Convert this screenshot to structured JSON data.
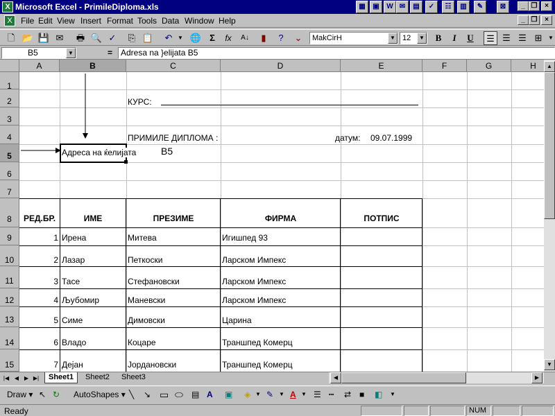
{
  "window": {
    "title": "Microsoft Excel - PrimileDiploma.xls",
    "app_icon_label": "X"
  },
  "menu": [
    "File",
    "Edit",
    "View",
    "Insert",
    "Format",
    "Tools",
    "Data",
    "Window",
    "Help"
  ],
  "toolbar": {
    "font_name": "MakCirH",
    "font_size": "12",
    "bold": "B",
    "italic": "I",
    "underline": "U"
  },
  "formula_bar": {
    "name_box": "B5",
    "equals": "=",
    "formula": "Adresa na }elijata B5"
  },
  "columns": [
    "A",
    "B",
    "C",
    "D",
    "E",
    "F",
    "G",
    "H"
  ],
  "rows": [
    "1",
    "2",
    "3",
    "4",
    "5",
    "6",
    "7",
    "8",
    "9",
    "10",
    "11",
    "12",
    "13",
    "14",
    "15"
  ],
  "sheet": {
    "course_label": "КУРС:",
    "received_label": "ПРИМИЛЕ ДИПЛОМА :",
    "date_label": "датум:",
    "date_value": "09.07.1999",
    "b5_text": "Адреса на ќелијата",
    "b5_ref": "B5",
    "headers": [
      "РЕД.БР.",
      "ИМЕ",
      "ПРЕЗИМЕ",
      "ФИРМА",
      "ПОТПИС"
    ],
    "data_rows": [
      {
        "no": "1",
        "name": "Ирена",
        "surname": "Митева",
        "company": "Игишпед 93"
      },
      {
        "no": "2",
        "name": "Лазар",
        "surname": "Петкоски",
        "company": "Ларском Импекс"
      },
      {
        "no": "3",
        "name": "Тасе",
        "surname": "Стефановски",
        "company": "Ларском Импекс"
      },
      {
        "no": "4",
        "name": "Љубомир",
        "surname": "Маневски",
        "company": "Ларском Импекс"
      },
      {
        "no": "5",
        "name": "Симе",
        "surname": "Димовски",
        "company": "Царина"
      },
      {
        "no": "6",
        "name": "Владо",
        "surname": "Коцаре",
        "company": "Траншпед Комерц"
      },
      {
        "no": "7",
        "name": "Дејан",
        "surname": "Јордановски",
        "company": "Траншпед Комерц"
      }
    ]
  },
  "tabs": [
    "Sheet1",
    "Sheet2",
    "Sheet3"
  ],
  "draw": {
    "draw_label": "Draw",
    "autoshapes_label": "AutoShapes"
  },
  "status": {
    "text": "Ready",
    "num": "NUM"
  }
}
